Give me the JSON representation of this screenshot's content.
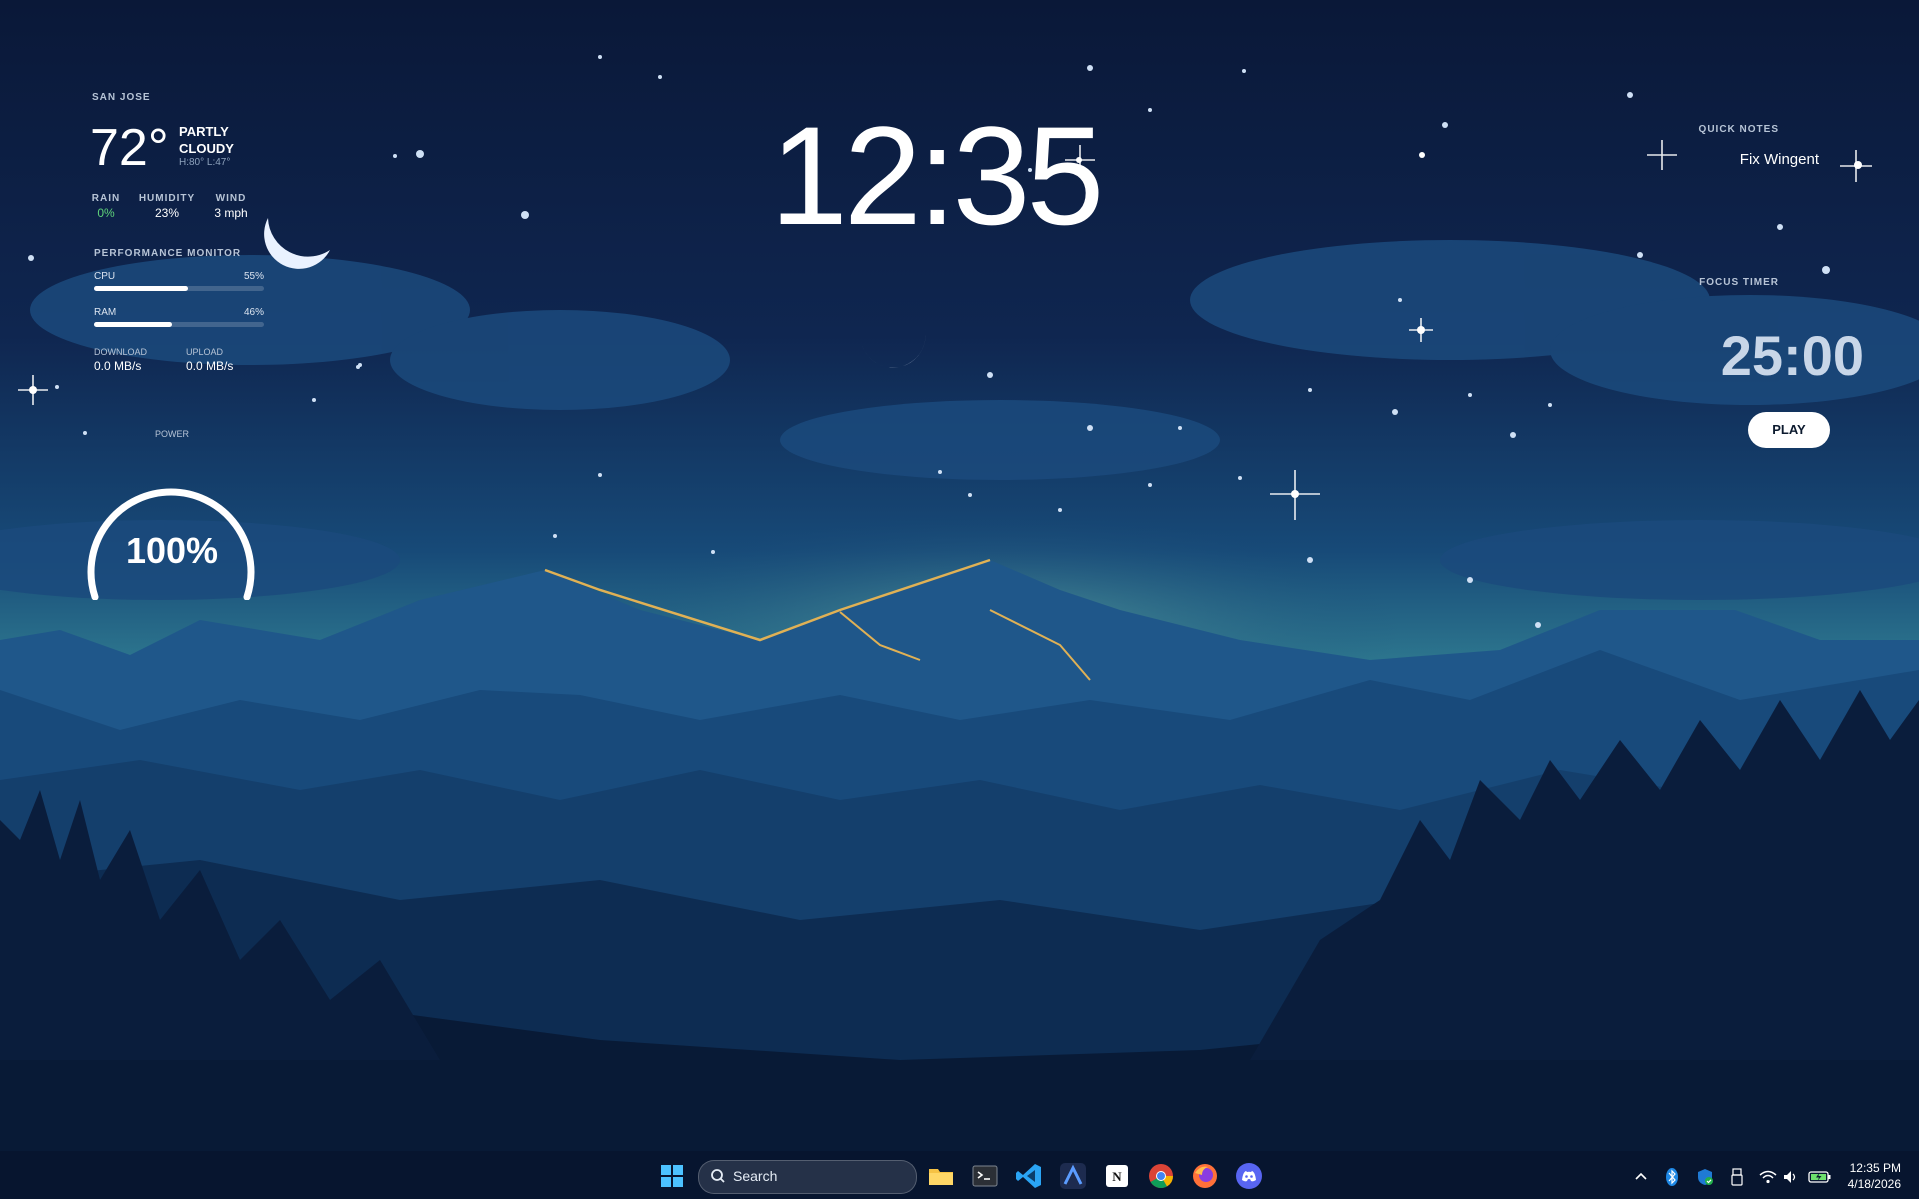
{
  "weather": {
    "city": "SAN JOSE",
    "temp": "72°",
    "condition": "PARTLY CLOUDY",
    "hilo": "H:80° L:47°",
    "stats": [
      {
        "label": "RAIN",
        "value": "0%"
      },
      {
        "label": "HUMIDITY",
        "value": "23%"
      },
      {
        "label": "WIND",
        "value": "3 mph"
      }
    ],
    "rain_color": "#5fd37a"
  },
  "performance": {
    "title": "PERFORMANCE MONITOR",
    "cpu_label": "CPU",
    "cpu_pct": "55%",
    "cpu_value": 0.55,
    "ram_label": "RAM",
    "ram_pct": "46%",
    "ram_value": 0.46,
    "download_label": "DOWNLOAD",
    "download_value": "0.0 MB/s",
    "upload_label": "UPLOAD",
    "upload_value": "0.0 MB/s"
  },
  "power": {
    "label": "POWER",
    "value": "100%",
    "level": 1.0
  },
  "clock": "12:35",
  "quick_notes": {
    "title": "QUICK NOTES",
    "items": [
      "Fix Wingent"
    ]
  },
  "focus_timer": {
    "title": "FOCUS TIMER",
    "time": "25:00",
    "play_label": "PLAY"
  },
  "taskbar": {
    "search_placeholder": "Search",
    "apps": [
      "windows-start-icon",
      "file-explorer-icon",
      "terminal-icon",
      "vscode-icon",
      "arc-icon",
      "notion-icon",
      "chrome-icon",
      "firefox-icon",
      "discord-icon"
    ],
    "tray_time": "12:35 PM",
    "tray_date": "4/18/2026"
  }
}
